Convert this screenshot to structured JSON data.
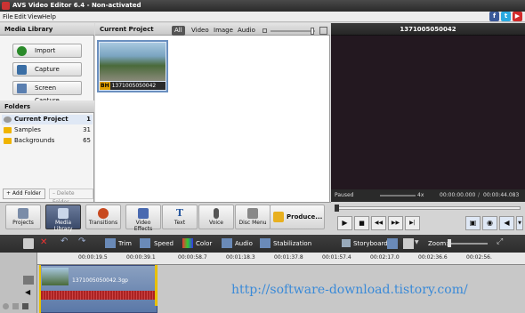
{
  "app": {
    "title": "AVS Video Editor 6.4 - Non-activated"
  },
  "menu": [
    "File",
    "Edit",
    "View",
    "Help"
  ],
  "social": [
    {
      "icon": "facebook-icon",
      "label": "f",
      "color": "#3b5998"
    },
    {
      "icon": "twitter-icon",
      "label": "t",
      "color": "#2aa9e0"
    },
    {
      "icon": "youtube-icon",
      "label": "▶",
      "color": "#d12b2b"
    }
  ],
  "media_library": {
    "title": "Media Library",
    "buttons": [
      "Import",
      "Capture",
      "Screen Capture"
    ],
    "folders_title": "Folders",
    "folders": [
      {
        "name": "Current Project",
        "count": "1"
      },
      {
        "name": "Samples",
        "count": "31"
      },
      {
        "name": "Backgrounds",
        "count": "65"
      }
    ],
    "add_folder": "+ Add Folder",
    "delete_folder": "– Delete Folder"
  },
  "project": {
    "title": "Current Project",
    "filters": [
      "All",
      "Video",
      "Image",
      "Audio"
    ],
    "active_filter": "All",
    "thumbnail_label": "1371005050042"
  },
  "preview": {
    "title": "1371005050042",
    "status": "Paused",
    "speed": "4x",
    "time_current": "00:00:00.000",
    "time_total": "00:00:44.083"
  },
  "main_toolbar": [
    "Projects",
    "Media Library",
    "Transitions",
    "Video Effects",
    "Text",
    "Voice",
    "Disc Menu"
  ],
  "produce": "Produce...",
  "edit_tools": [
    "Trim",
    "Speed",
    "Color",
    "Audio",
    "Stabilization"
  ],
  "storyboard": "Storyboard",
  "zoom_label": "Zoom:",
  "ruler": [
    "00:00:19.5",
    "00:00:39.1",
    "00:00:58.7",
    "00:01:18.3",
    "00:01:37.8",
    "00:01:57.4",
    "00:02:17.0",
    "00:02:36.6",
    "00:02:56."
  ],
  "clip": {
    "name": "1371005050042.3gp"
  },
  "watermark": "http://software-download.tistory.com/"
}
